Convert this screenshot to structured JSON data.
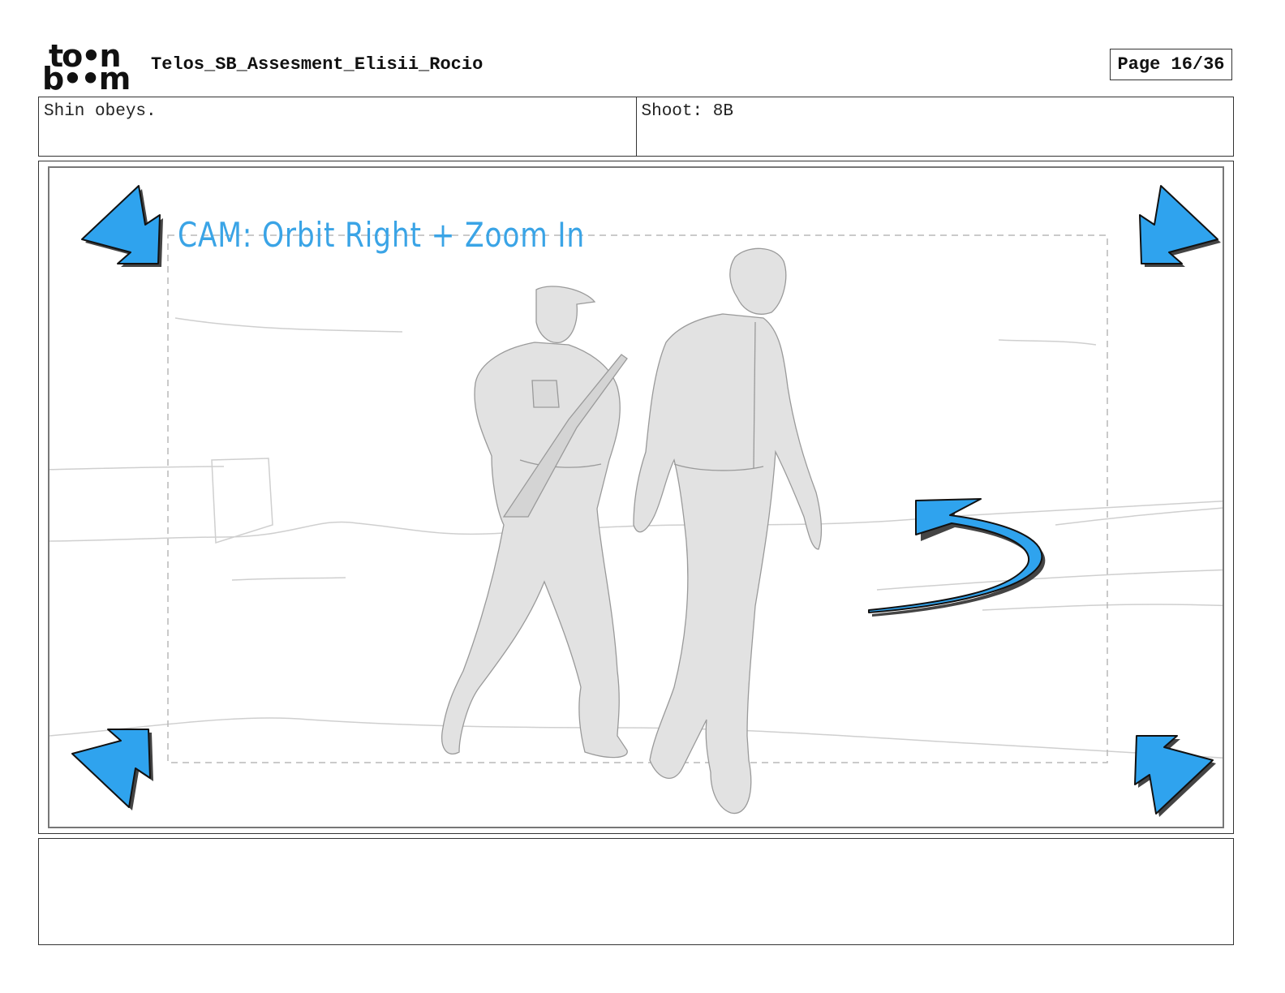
{
  "header": {
    "logo_line1": "to•n",
    "logo_line2": "b••m",
    "title": "Telos_SB_Assesment_Elisii_Rocio",
    "page_label": "Page 16/36"
  },
  "info": {
    "action": "Shin obeys.",
    "shot": "Shoot: 8B"
  },
  "panel": {
    "camera_note": "CAM: Orbit Right + Zoom In"
  },
  "notes": {
    "dialogue": ""
  },
  "colors": {
    "arrow_blue": "#2fa3ee",
    "label_blue": "#3aa4e6",
    "sketch_gray": "#d9d9d9"
  }
}
